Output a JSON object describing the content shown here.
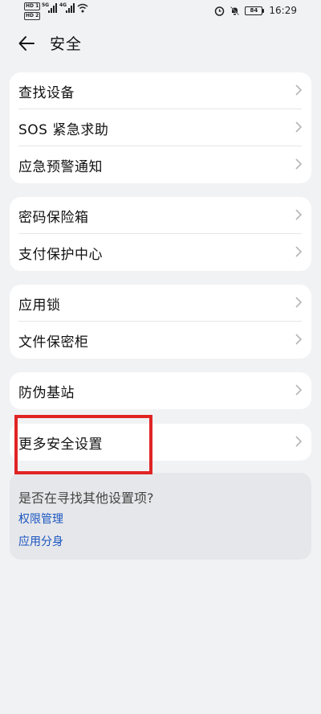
{
  "status_bar": {
    "hd1": "HD 1",
    "hd2": "HD 2",
    "net1": "5G",
    "net2": "4G",
    "battery_level": "84",
    "time": "16:29"
  },
  "header": {
    "back_icon": "back-arrow-icon",
    "title": "安全"
  },
  "groups": [
    {
      "items": [
        {
          "label": "查找设备"
        },
        {
          "label": "SOS 紧急求助"
        },
        {
          "label": "应急预警通知"
        }
      ]
    },
    {
      "items": [
        {
          "label": "密码保险箱"
        },
        {
          "label": "支付保护中心"
        }
      ]
    },
    {
      "items": [
        {
          "label": "应用锁"
        },
        {
          "label": "文件保密柜"
        }
      ]
    },
    {
      "items": [
        {
          "label": "防伪基站"
        }
      ]
    },
    {
      "items": [
        {
          "label": "更多安全设置"
        }
      ]
    }
  ],
  "suggestion": {
    "question": "是否在寻找其他设置项?",
    "links": [
      "权限管理",
      "应用分身"
    ]
  },
  "colors": {
    "background": "#f1f2f4",
    "card": "#ffffff",
    "link": "#1a56c2",
    "highlight": "#e02424"
  }
}
